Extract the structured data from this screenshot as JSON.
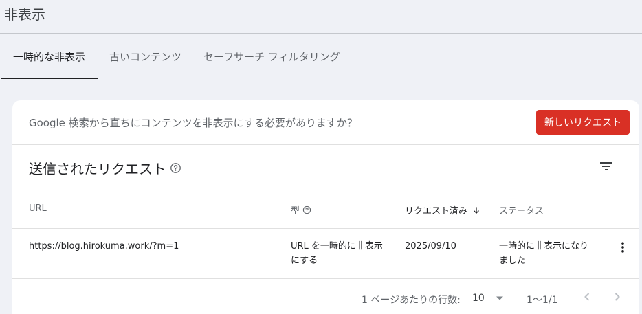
{
  "page": {
    "title": "非表示"
  },
  "tabs": [
    {
      "label": "一時的な非表示"
    },
    {
      "label": "古いコンテンツ"
    },
    {
      "label": "セーフサーチ フィルタリング"
    }
  ],
  "card": {
    "prompt": "Google 検索から直ちにコンテンツを非表示にする必要がありますか？",
    "new_request_label": "新しいリクエスト",
    "section_title": "送信されたリクエスト",
    "columns": {
      "url": "URL",
      "type": "型",
      "requested": "リクエスト済み",
      "status": "ステータス"
    },
    "rows": [
      {
        "url": "https://blog.hirokuma.work/?m=1",
        "type_line1": "URL を一時的に非表示",
        "type_line2": "にする",
        "date": "2025/09/10",
        "status_line1": "一時的に非表示になり",
        "status_line2": "ました"
      }
    ],
    "pagination": {
      "rows_per_page_label": "1 ページあたりの行数:",
      "rows_per_page_value": "10",
      "range": "1〜1/1"
    }
  },
  "colors": {
    "primary_button": "#d93025",
    "background": "#eff1f6"
  },
  "icons": [
    "help-icon",
    "filter-icon",
    "sort-arrow-icon",
    "more-vert-icon",
    "dropdown-icon",
    "chevron-left-icon",
    "chevron-right-icon"
  ]
}
